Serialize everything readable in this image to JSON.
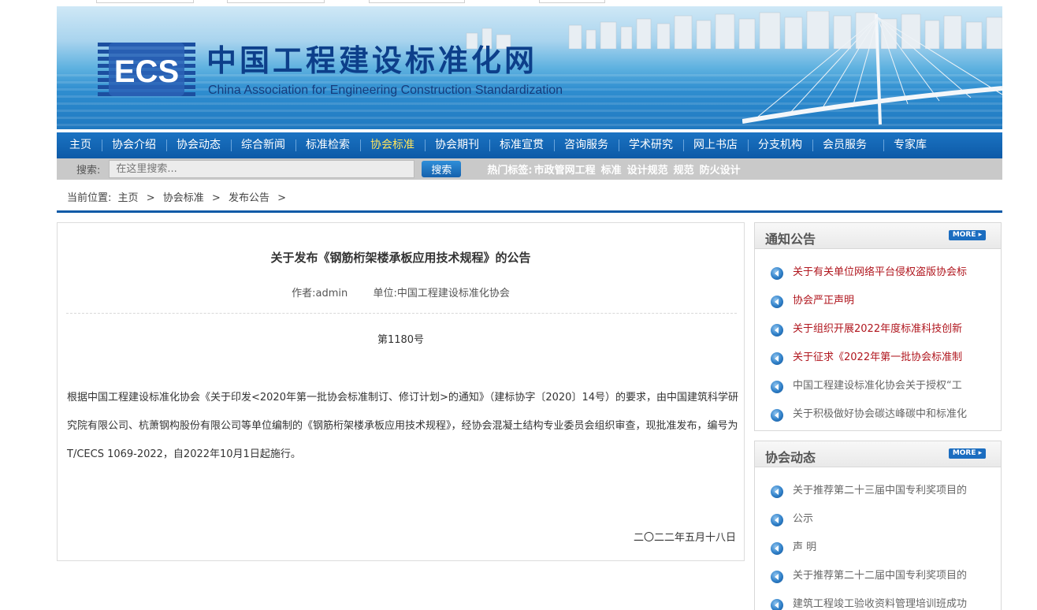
{
  "site": {
    "title": "中国工程建设标准化网",
    "subtitle": "China Association for Engineering Construction Standardization",
    "logo_text": "ECS"
  },
  "nav": {
    "items": [
      "主页",
      "协会介绍",
      "协会动态",
      "综合新闻",
      "标准检索",
      "协会标准",
      "协会期刊",
      "标准宣贯",
      "咨询服务",
      "学术研究",
      "网上书店",
      "分支机构",
      "会员服务",
      "专家库"
    ],
    "active_index": 5
  },
  "search": {
    "label": "搜索:",
    "placeholder": "在这里搜索...",
    "button": "搜索",
    "hot_label": "热门标签:",
    "hot_tags": [
      "市政管网工程",
      "标准",
      "设计规范",
      "规范",
      "防火设计"
    ]
  },
  "breadcrumb": {
    "label": "当前位置:",
    "items": [
      "主页",
      "协会标准",
      "发布公告"
    ],
    "separator": ">"
  },
  "article": {
    "title": "关于发布《钢筋桁架楼承板应用技术规程》的公告",
    "author": "作者:admin",
    "unit": "单位:中国工程建设标准化协会",
    "number": "第1180号",
    "body": "根据中国工程建设标准化协会《关于印发<2020年第一批协会标准制订、修订计划>的通知》（建标协字〔2020〕14号）的要求，由中国建筑科学研究院有限公司、杭萧钢构股份有限公司等单位编制的《钢筋桁架楼承板应用技术规程》，经协会混凝土结构专业委员会组织审查，现批准发布，编号为T/CECS 1069-2022，自2022年10月1日起施行。",
    "date": "二〇二二年五月十八日"
  },
  "notice_box": {
    "title": "通知公告",
    "more": "MORE",
    "items": [
      {
        "text": "关于有关单位网络平台侵权盗版协会标",
        "style": "red"
      },
      {
        "text": "协会严正声明",
        "style": "red"
      },
      {
        "text": "关于组织开展2022年度标准科技创新",
        "style": "red"
      },
      {
        "text": "关于征求《2022年第一批协会标准制",
        "style": "red"
      },
      {
        "text": "中国工程建设标准化协会关于授权“工",
        "style": "gray"
      },
      {
        "text": "关于积极做好协会碳达峰碳中和标准化",
        "style": "gray"
      }
    ]
  },
  "news_box": {
    "title": "协会动态",
    "more": "MORE",
    "items": [
      {
        "text": "关于推荐第二十三届中国专利奖项目的",
        "style": "gray"
      },
      {
        "text": "公示",
        "style": "gray"
      },
      {
        "text": "声 明",
        "style": "gray"
      },
      {
        "text": "关于推荐第二十二届中国专利奖项目的",
        "style": "gray"
      },
      {
        "text": "建筑工程竣工验收资料管理培训班成功",
        "style": "gray"
      }
    ]
  },
  "colors": {
    "nav_bg": "#0d5aa7",
    "nav_active": "#ffe45c",
    "notice_red": "#b0161e",
    "accent_blue": "#1b6dc0"
  }
}
